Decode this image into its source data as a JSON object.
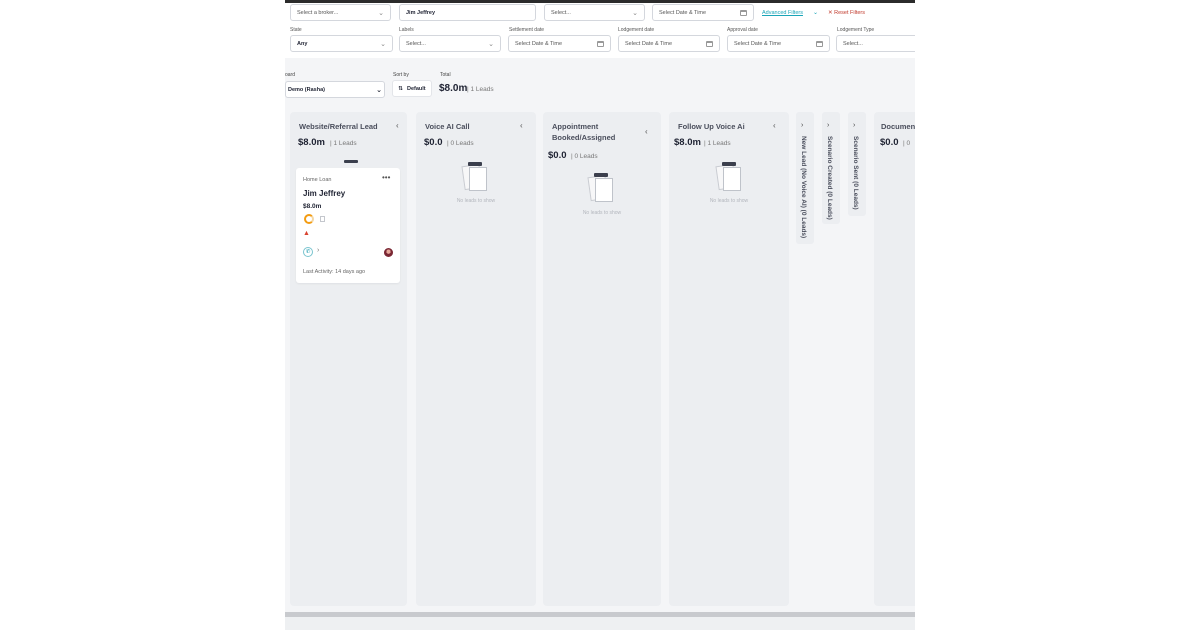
{
  "filters": {
    "broker_placeholder": "Select a broker...",
    "client_value": "Jim Jeffrey",
    "select3_placeholder": "Select...",
    "date_placeholder": "Select Date & Time",
    "advanced_filters": "Advanced Filters",
    "reset_filters": "Reset Filters",
    "state_label": "State",
    "state_value": "Any",
    "labels_label": "Labels",
    "labels_placeholder": "Select...",
    "settlement_label": "Settlement date",
    "settlement_placeholder": "Select Date & Time",
    "lodgement_label": "Lodgement date",
    "lodgement_placeholder": "Select Date & Time",
    "approval_label": "Approval date",
    "approval_placeholder": "Select Date & Time",
    "lodgement_type_label": "Lodgement Type",
    "lodgement_type_placeholder": "Select..."
  },
  "summary": {
    "board_label": "oard",
    "board_value": "Demo (Rasha)",
    "sort_label": "Sort by",
    "sort_value": "Default",
    "total_label": "Total",
    "total_amount": "$8.0m",
    "total_leads": "1 Leads"
  },
  "columns": [
    {
      "title": "Website/Referral Lead",
      "amount": "$8.0m",
      "leads": "1 Leads"
    },
    {
      "title": "Voice AI Call",
      "amount": "$0.0",
      "leads": "0 Leads",
      "empty_text": "No leads to show"
    },
    {
      "title": "Appointment Booked/Assigned",
      "amount": "$0.0",
      "leads": "0 Leads",
      "empty_text": "No leads to show"
    },
    {
      "title": "Follow Up Voice Ai",
      "amount": "$8.0m",
      "leads": "1 Leads",
      "empty_text": "No leads to show"
    },
    {
      "title": "Documen",
      "amount": "$0.0",
      "leads": "0"
    }
  ],
  "collapsed_columns": [
    {
      "title": "New Lead (No Voice AI) (0 Leads)"
    },
    {
      "title": "Scenario Created (0 Leads)"
    },
    {
      "title": "Scenario Sent (0 Leads)"
    }
  ],
  "card": {
    "type": "Home Loan",
    "name": "Jim Jeffrey",
    "amount": "$8.0m",
    "last_activity": "Last Activity: 14 days ago"
  },
  "icons": {
    "chevron_down": "chevron-down-icon",
    "calendar": "calendar-icon",
    "collapse_left": "chevron-left-icon",
    "expand_right": "chevron-right-icon"
  },
  "colors": {
    "accent": "#1aa5b8",
    "reset": "#c0392b",
    "warning": "#d9432f",
    "progress": "#f39c12"
  }
}
